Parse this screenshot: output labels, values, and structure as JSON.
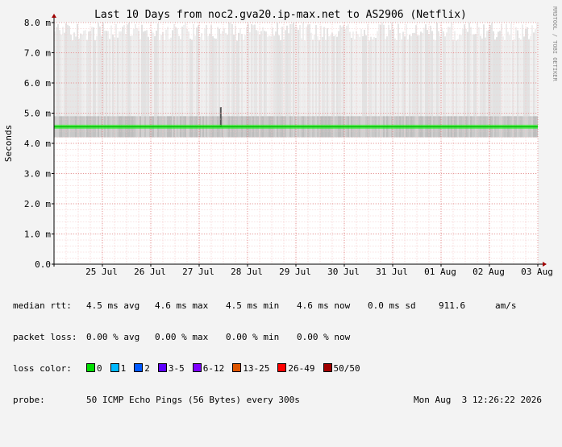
{
  "chart_data": {
    "type": "area",
    "title": "Last 10 Days from noc2.gva20.ip-max.net to AS2906 (Netflix)",
    "ylabel": "Seconds",
    "side_label": "RRDTOOL / TOBI OETIKER",
    "ylim": [
      0,
      8.0
    ],
    "y_ticks": [
      {
        "value": 0.0,
        "label": "0.0"
      },
      {
        "value": 1.0,
        "label": "1.0 m"
      },
      {
        "value": 2.0,
        "label": "2.0 m"
      },
      {
        "value": 3.0,
        "label": "3.0 m"
      },
      {
        "value": 4.0,
        "label": "4.0 m"
      },
      {
        "value": 5.0,
        "label": "5.0 m"
      },
      {
        "value": 6.0,
        "label": "6.0 m"
      },
      {
        "value": 7.0,
        "label": "7.0 m"
      },
      {
        "value": 8.0,
        "label": "8.0 m"
      }
    ],
    "x_ticks": [
      "25 Jul",
      "26 Jul",
      "27 Jul",
      "28 Jul",
      "29 Jul",
      "30 Jul",
      "31 Jul",
      "01 Aug",
      "02 Aug",
      "03 Aug"
    ],
    "x_tick_days": [
      1,
      2,
      3,
      4,
      5,
      6,
      7,
      8,
      9,
      10
    ],
    "x_range_days": [
      0,
      10.0
    ],
    "median_rtt": 4.55,
    "smoke_range": [
      4.2,
      8.0
    ],
    "spike_day": 3.43,
    "grid": true,
    "series_color": "#00ff00",
    "median_color": "#00c000"
  },
  "legend": {
    "median_rtt": {
      "label": "median rtt:",
      "avg": "4.5 ms avg",
      "max": "4.6 ms max",
      "min": "4.5 ms min",
      "now": "4.6 ms now",
      "sd": "0.0 ms sd",
      "rate": "911.6",
      "rate_unit": "am/s"
    },
    "packet_loss": {
      "label": "packet loss:",
      "avg": "0.00 % avg",
      "max": "0.00 % max",
      "min": "0.00 % min",
      "now": "0.00 % now"
    },
    "loss_color": {
      "label": "loss color:",
      "items": [
        {
          "label": "0",
          "color": "#00dd00"
        },
        {
          "label": "1",
          "color": "#00b8ff"
        },
        {
          "label": "2",
          "color": "#0059ff"
        },
        {
          "label": "3-5",
          "color": "#5e00ff"
        },
        {
          "label": "6-12",
          "color": "#7e00ff"
        },
        {
          "label": "13-25",
          "color": "#dd5500"
        },
        {
          "label": "26-49",
          "color": "#ff0000"
        },
        {
          "label": "50/50",
          "color": "#a00000"
        }
      ]
    },
    "probe": {
      "label": "probe:",
      "text": "50 ICMP Echo Pings (56 Bytes) every 300s",
      "timestamp": "Mon Aug  3 12:26:22 2026"
    }
  }
}
